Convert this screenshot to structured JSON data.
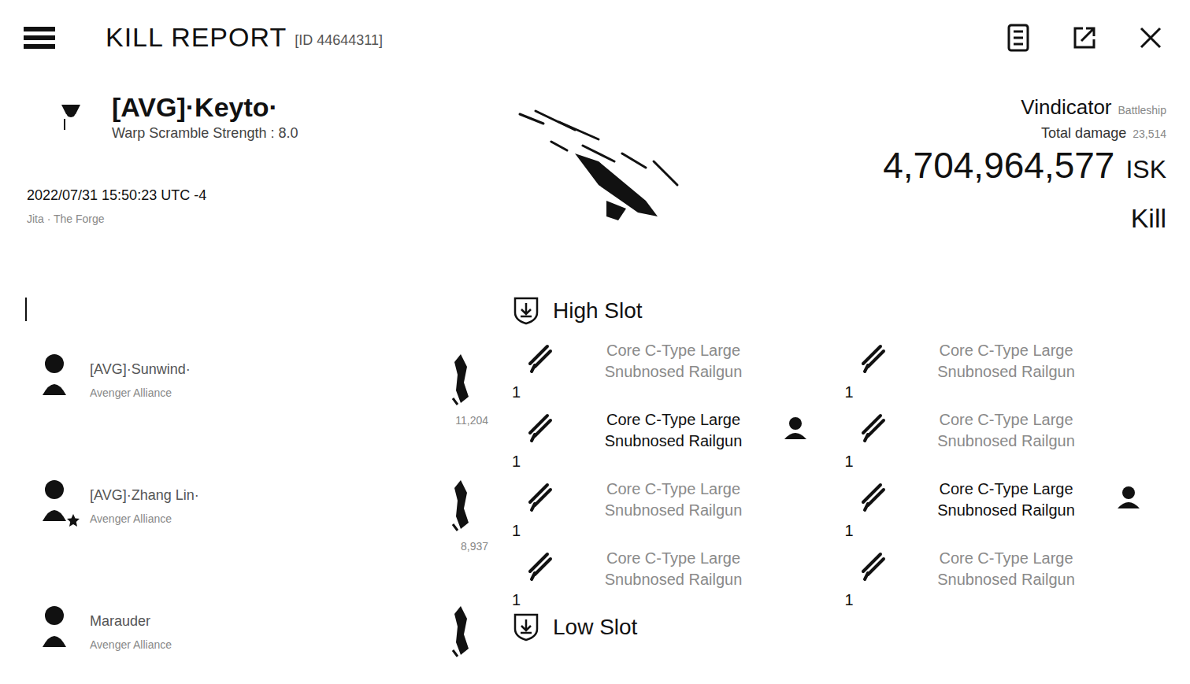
{
  "header": {
    "title": "KILL REPORT",
    "id": "[ID 44644311]"
  },
  "victim": {
    "name": "[AVG]·Keyto·",
    "stat": "Warp Scramble Strength : 8.0",
    "time": "2022/07/31 15:50:23 UTC -4",
    "location": "Jita · The Forge"
  },
  "summary": {
    "ship": "Vindicator",
    "ship_class": "Battleship",
    "damage_label": "Total damage",
    "damage": "23,514",
    "value": "4,704,964,577",
    "currency": "ISK",
    "result": "Kill"
  },
  "attackers": [
    {
      "name": "[AVG]·Sunwind·",
      "corp": "Avenger Alliance",
      "damage": "11,204",
      "final_blow": false
    },
    {
      "name": "[AVG]·Zhang Lin·",
      "corp": "Avenger Alliance",
      "damage": "8,937",
      "final_blow": true
    },
    {
      "name": "Marauder",
      "corp": "Avenger Alliance",
      "final_blow": false
    }
  ],
  "sections": [
    {
      "title": "High Slot",
      "items": [
        {
          "qty": "1",
          "name": "Core C-Type Large Snubnosed Railgun",
          "dropped": false
        },
        {
          "qty": "1",
          "name": "Core C-Type Large Snubnosed Railgun",
          "dropped": false
        },
        {
          "qty": "1",
          "name": "Core C-Type Large Snubnosed Railgun",
          "dropped": true
        },
        {
          "qty": "1",
          "name": "Core C-Type Large Snubnosed Railgun",
          "dropped": false
        },
        {
          "qty": "1",
          "name": "Core C-Type Large Snubnosed Railgun",
          "dropped": false
        },
        {
          "qty": "1",
          "name": "Core C-Type Large Snubnosed Railgun",
          "dropped": true
        },
        {
          "qty": "1",
          "name": "Core C-Type Large Snubnosed Railgun",
          "dropped": false
        },
        {
          "qty": "1",
          "name": "Core C-Type Large Snubnosed Railgun",
          "dropped": false
        }
      ]
    },
    {
      "title": "Low Slot",
      "items": []
    }
  ]
}
